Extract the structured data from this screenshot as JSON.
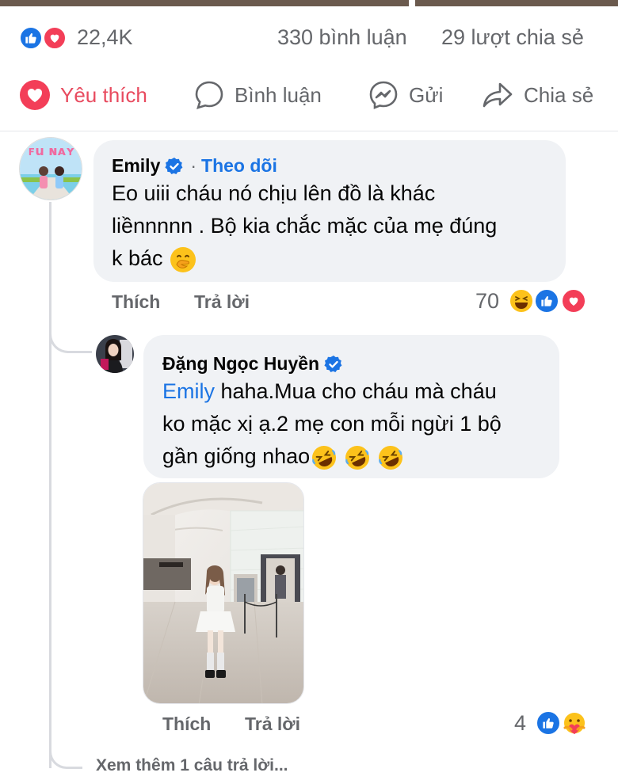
{
  "post_stats": {
    "reaction_icons": [
      "like-icon",
      "love-icon"
    ],
    "reaction_count": "22,4K",
    "comments": "330 bình luận",
    "shares": "29 lượt chia sẻ"
  },
  "actions": {
    "like": "Yêu thích",
    "comment": "Bình luận",
    "send": "Gửi",
    "share": "Chia sẻ"
  },
  "comments": [
    {
      "author": "Emily",
      "verified": true,
      "separator": "·",
      "follow_label": "Theo dõi",
      "lines": [
        "Eo uiii cháu nó chịu lên đồ là khác",
        "liềnnnnn . Bộ kia chắc mặc của mẹ đúng",
        "k bác"
      ],
      "emoji": "hand-over-mouth-emoji",
      "like_label": "Thích",
      "reply_label": "Trả lời",
      "reaction_count": "70",
      "reaction_icons": [
        "haha-icon",
        "like-icon",
        "love-icon"
      ]
    }
  ],
  "reply": {
    "author": "Đặng Ngọc Huyền",
    "verified": true,
    "mention": "Emily",
    "line1_rest": " haha.Mua cho cháu mà cháu",
    "line2": "ko mặc xị ạ.2 mẹ con mỗi ngừi 1 bộ",
    "line3": "gần giống nhao",
    "emojis": [
      "rofl-emoji",
      "rofl-emoji",
      "rofl-emoji"
    ],
    "photo_icon": "mall-photo",
    "like_label": "Thích",
    "reply_label": "Trả lời",
    "reaction_count": "4",
    "reaction_icons": [
      "like-icon",
      "care-icon"
    ]
  },
  "more_replies": "Xem thêm 1 câu trả lời...",
  "colors": {
    "facebook_blue": "#1b74e4",
    "love_red": "#f33e58",
    "bubble_gray": "#f0f2f5",
    "meta_gray": "#65676b"
  }
}
